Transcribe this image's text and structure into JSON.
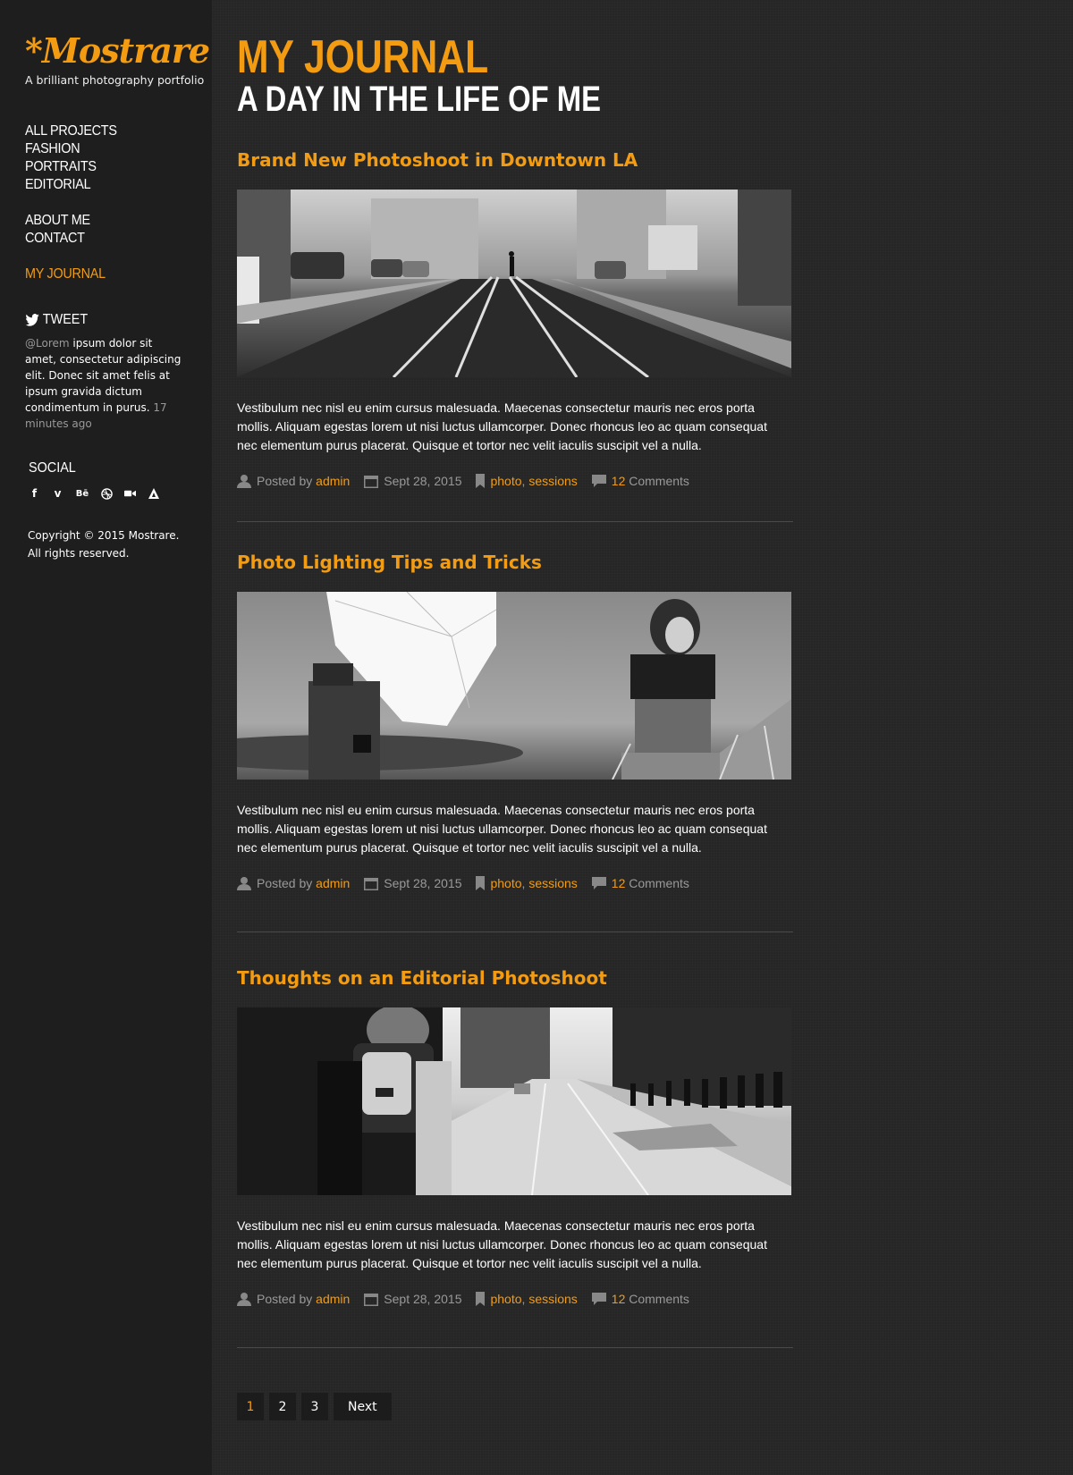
{
  "brand": {
    "logo": "*Mostrare",
    "tagline": "A brilliant photography portfolio"
  },
  "nav": {
    "group1": [
      "ALL PROJECTS",
      "FASHION",
      "PORTRAITS",
      "EDITORIAL"
    ],
    "group2": [
      "ABOUT ME",
      "CONTACT"
    ],
    "active": "MY JOURNAL"
  },
  "tweet": {
    "heading": "TWEET",
    "handle": "@Lorem",
    "text": " ipsum dolor sit amet, consectetur adipiscing elit. Donec sit amet felis at ipsum gravida dictum condimentum in purus.",
    "time": "17 minutes ago"
  },
  "social": {
    "heading": "SOCIAL",
    "icons": [
      "facebook-icon",
      "vimeo-icon",
      "behance-icon",
      "dribbble-icon",
      "video-icon",
      "vine-icon"
    ]
  },
  "copyright": {
    "line1": "Copyright © 2015 Mostrare.",
    "line2": "All rights reserved."
  },
  "page": {
    "title": "MY JOURNAL",
    "subtitle": "A DAY IN THE LIFE OF ME"
  },
  "posts": [
    {
      "title": "Brand New Photoshoot in Downtown LA",
      "body": "Vestibulum nec nisl eu enim cursus malesuada. Maecenas consectetur mauris nec eros porta mollis. Aliquam egestas lorem ut nisi luctus ullamcorper. Donec rhoncus leo ac quam consequat nec elementum purus placerat. Quisque et tortor nec velit iaculis suscipit vel a nulla.",
      "posted_by_label": "Posted by",
      "author": "admin",
      "date": "Sept 28, 2015",
      "tag1": "photo",
      "tag2": "sessions",
      "comment_count": "12",
      "comments_label": "Comments"
    },
    {
      "title": "Photo Lighting Tips and Tricks",
      "body": "Vestibulum nec nisl eu enim cursus malesuada. Maecenas consectetur mauris nec eros porta mollis. Aliquam egestas lorem ut nisi luctus ullamcorper. Donec rhoncus leo ac quam consequat nec elementum purus placerat. Quisque et tortor nec velit iaculis suscipit vel a nulla.",
      "posted_by_label": "Posted by",
      "author": "admin",
      "date": "Sept 28, 2015",
      "tag1": "photo",
      "tag2": "sessions",
      "comment_count": "12",
      "comments_label": "Comments"
    },
    {
      "title": "Thoughts on an Editorial Photoshoot",
      "body": "Vestibulum nec nisl eu enim cursus malesuada. Maecenas consectetur mauris nec eros porta mollis. Aliquam egestas lorem ut nisi luctus ullamcorper. Donec rhoncus leo ac quam consequat nec elementum purus placerat. Quisque et tortor nec velit iaculis suscipit vel a nulla.",
      "posted_by_label": "Posted by",
      "author": "admin",
      "date": "Sept 28, 2015",
      "tag1": "photo",
      "tag2": "sessions",
      "comment_count": "12",
      "comments_label": "Comments"
    }
  ],
  "pagination": {
    "pages": [
      "1",
      "2",
      "3"
    ],
    "current": "1",
    "next": "Next"
  },
  "colors": {
    "accent": "#f39c12",
    "sidebar_bg": "#1e1e1e",
    "page_bg": "#262626",
    "muted_text": "#999999"
  }
}
